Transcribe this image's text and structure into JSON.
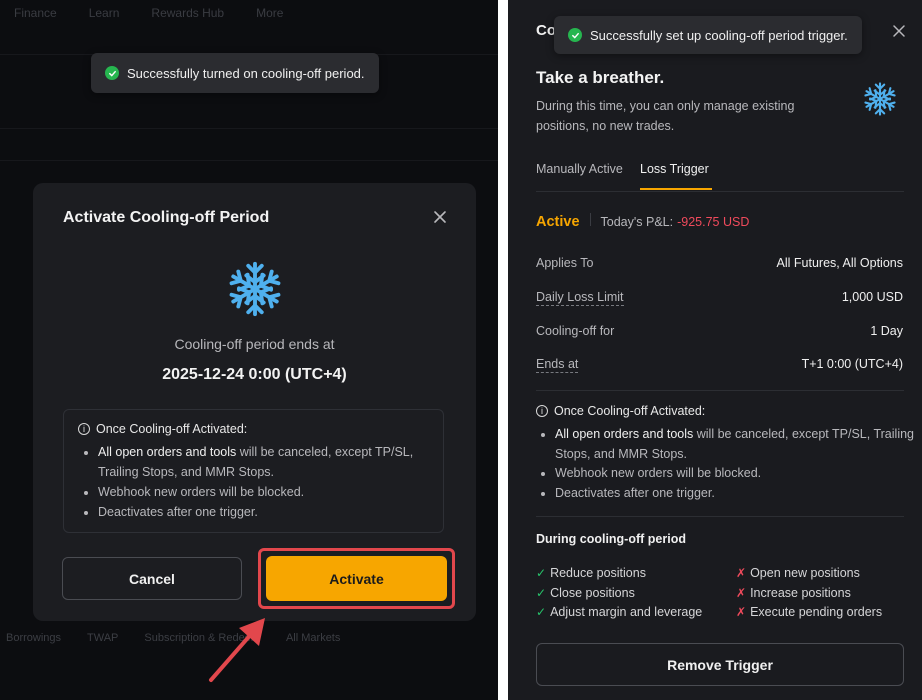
{
  "left": {
    "bg_nav": [
      "Finance",
      "Learn",
      "Rewards Hub",
      "More"
    ],
    "toast": {
      "text": "Successfully turned on cooling-off period."
    },
    "dialog": {
      "title": "Activate Cooling-off Period",
      "ends_label": "Cooling-off period ends at",
      "ends_value": "2025-12-24 0:00 (UTC+4)",
      "info_head": "Once Cooling-off Activated:",
      "info_items": [
        {
          "em": "All open orders and tools",
          "rest": " will be canceled, except TP/SL, Trailing Stops, and MMR Stops."
        },
        {
          "em": "",
          "rest": "Webhook new orders will be blocked."
        },
        {
          "em": "",
          "rest": "Deactivates after one trigger."
        }
      ],
      "cancel_label": "Cancel",
      "activate_label": "Activate"
    },
    "bg_bottom": [
      "Borrowings",
      "TWAP",
      "Subscription & Redeem",
      "All Markets"
    ]
  },
  "right": {
    "title_fragment": "Co",
    "toast": {
      "text": "Successfully set up cooling-off period trigger."
    },
    "headline": "Take a breather.",
    "description": "During this time, you can only manage existing positions, no new trades.",
    "tabs": [
      {
        "label": "Manually Active",
        "active": false
      },
      {
        "label": "Loss Trigger",
        "active": true
      }
    ],
    "status": "Active",
    "pnl_label": "Today's P&L:",
    "pnl_value": "-925.75 USD",
    "rows": [
      {
        "key": "Applies To",
        "value": "All Futures, All Options",
        "dashed": false
      },
      {
        "key": "Daily Loss Limit",
        "value": "1,000 USD",
        "dashed": true
      },
      {
        "key": "Cooling-off for",
        "value": "1 Day",
        "dashed": false
      },
      {
        "key": "Ends at",
        "value": "T+1 0:00 (UTC+4)",
        "dashed": true
      }
    ],
    "info_head": "Once Cooling-off Activated:",
    "info_items": [
      {
        "em": "All open orders and tools",
        "rest": " will be canceled, except TP/SL, Trailing Stops, and MMR Stops."
      },
      {
        "em": "",
        "rest": "Webhook new orders will be blocked."
      },
      {
        "em": "",
        "rest": "Deactivates after one trigger."
      }
    ],
    "during_title": "During cooling-off period",
    "allowed": [
      "Reduce positions",
      "Close positions",
      "Adjust margin and leverage"
    ],
    "blocked": [
      "Open new positions",
      "Increase positions",
      "Execute pending orders"
    ],
    "remove_label": "Remove Trigger"
  },
  "colors": {
    "accent": "#f7a600",
    "success": "#26b64f",
    "danger": "#f04a5c",
    "highlight_border": "#e2474c",
    "snowflake": "#4fb0ee"
  },
  "icons": [
    "check-circle-icon",
    "close-icon",
    "snowflake-icon",
    "info-icon",
    "checkmark-icon",
    "cross-icon",
    "pointer-arrow"
  ]
}
